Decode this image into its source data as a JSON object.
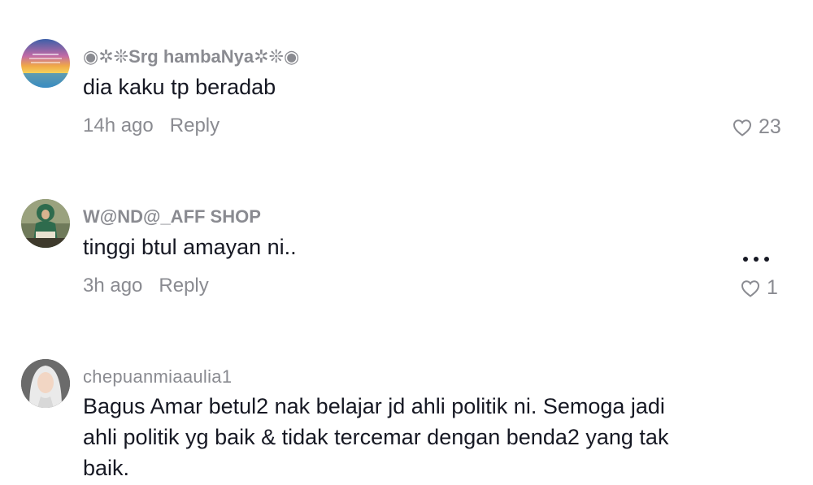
{
  "comments": [
    {
      "username": "◉✲❊Srg hambaNya✲❊◉",
      "text": "dia kaku tp beradab",
      "time": "14h ago",
      "reply_label": "Reply",
      "likes": "23",
      "avatar": "sunset-sea-avatar"
    },
    {
      "username": "W@ND@_AFF SHOP",
      "text": "tinggi btul amayan ni..",
      "time": "3h ago",
      "reply_label": "Reply",
      "likes": "1",
      "avatar": "hijab-woman-reading-avatar"
    },
    {
      "username": "chepuanmiaaulia1",
      "text": "Bagus Amar betul2 nak belajar jd ahli politik ni. Semoga jadi ahli politik yg baik & tidak tercemar dengan benda2 yang tak baik.",
      "avatar": "hijab-woman-portrait-avatar"
    }
  ],
  "icons": {
    "like": "heart-outline-icon",
    "more": "more-options-icon"
  },
  "colors": {
    "primary_text": "#161823",
    "secondary_text": "#8a8b91",
    "background": "#ffffff"
  }
}
